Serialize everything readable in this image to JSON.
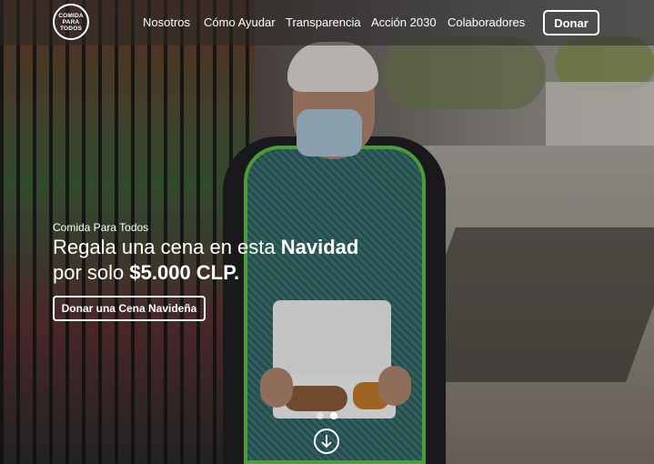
{
  "brand": {
    "logo_lines": [
      "COMIDA",
      "PARA",
      "TODOS"
    ]
  },
  "nav": {
    "items": [
      {
        "label": "Nosotros"
      },
      {
        "label": "Cómo Ayudar"
      },
      {
        "label": "Transparencia"
      },
      {
        "label": "Acción 2030"
      },
      {
        "label": "Colaboradores"
      }
    ],
    "donate_label": "Donar"
  },
  "hero": {
    "eyebrow": "Comida Para Todos",
    "headline_part1": "Regala una cena en esta ",
    "headline_bold1": "Navidad",
    "headline_part2": "por solo ",
    "headline_bold2": "$5.000 CLP.",
    "cta_label": "Donar una Cena Navideña"
  },
  "carousel": {
    "total_slides": 2,
    "active_slide": 2
  },
  "colors": {
    "text": "#ffffff",
    "apron_trim": "#5fbf4a"
  },
  "icons": {
    "scroll": "arrow-down-circle-icon"
  }
}
